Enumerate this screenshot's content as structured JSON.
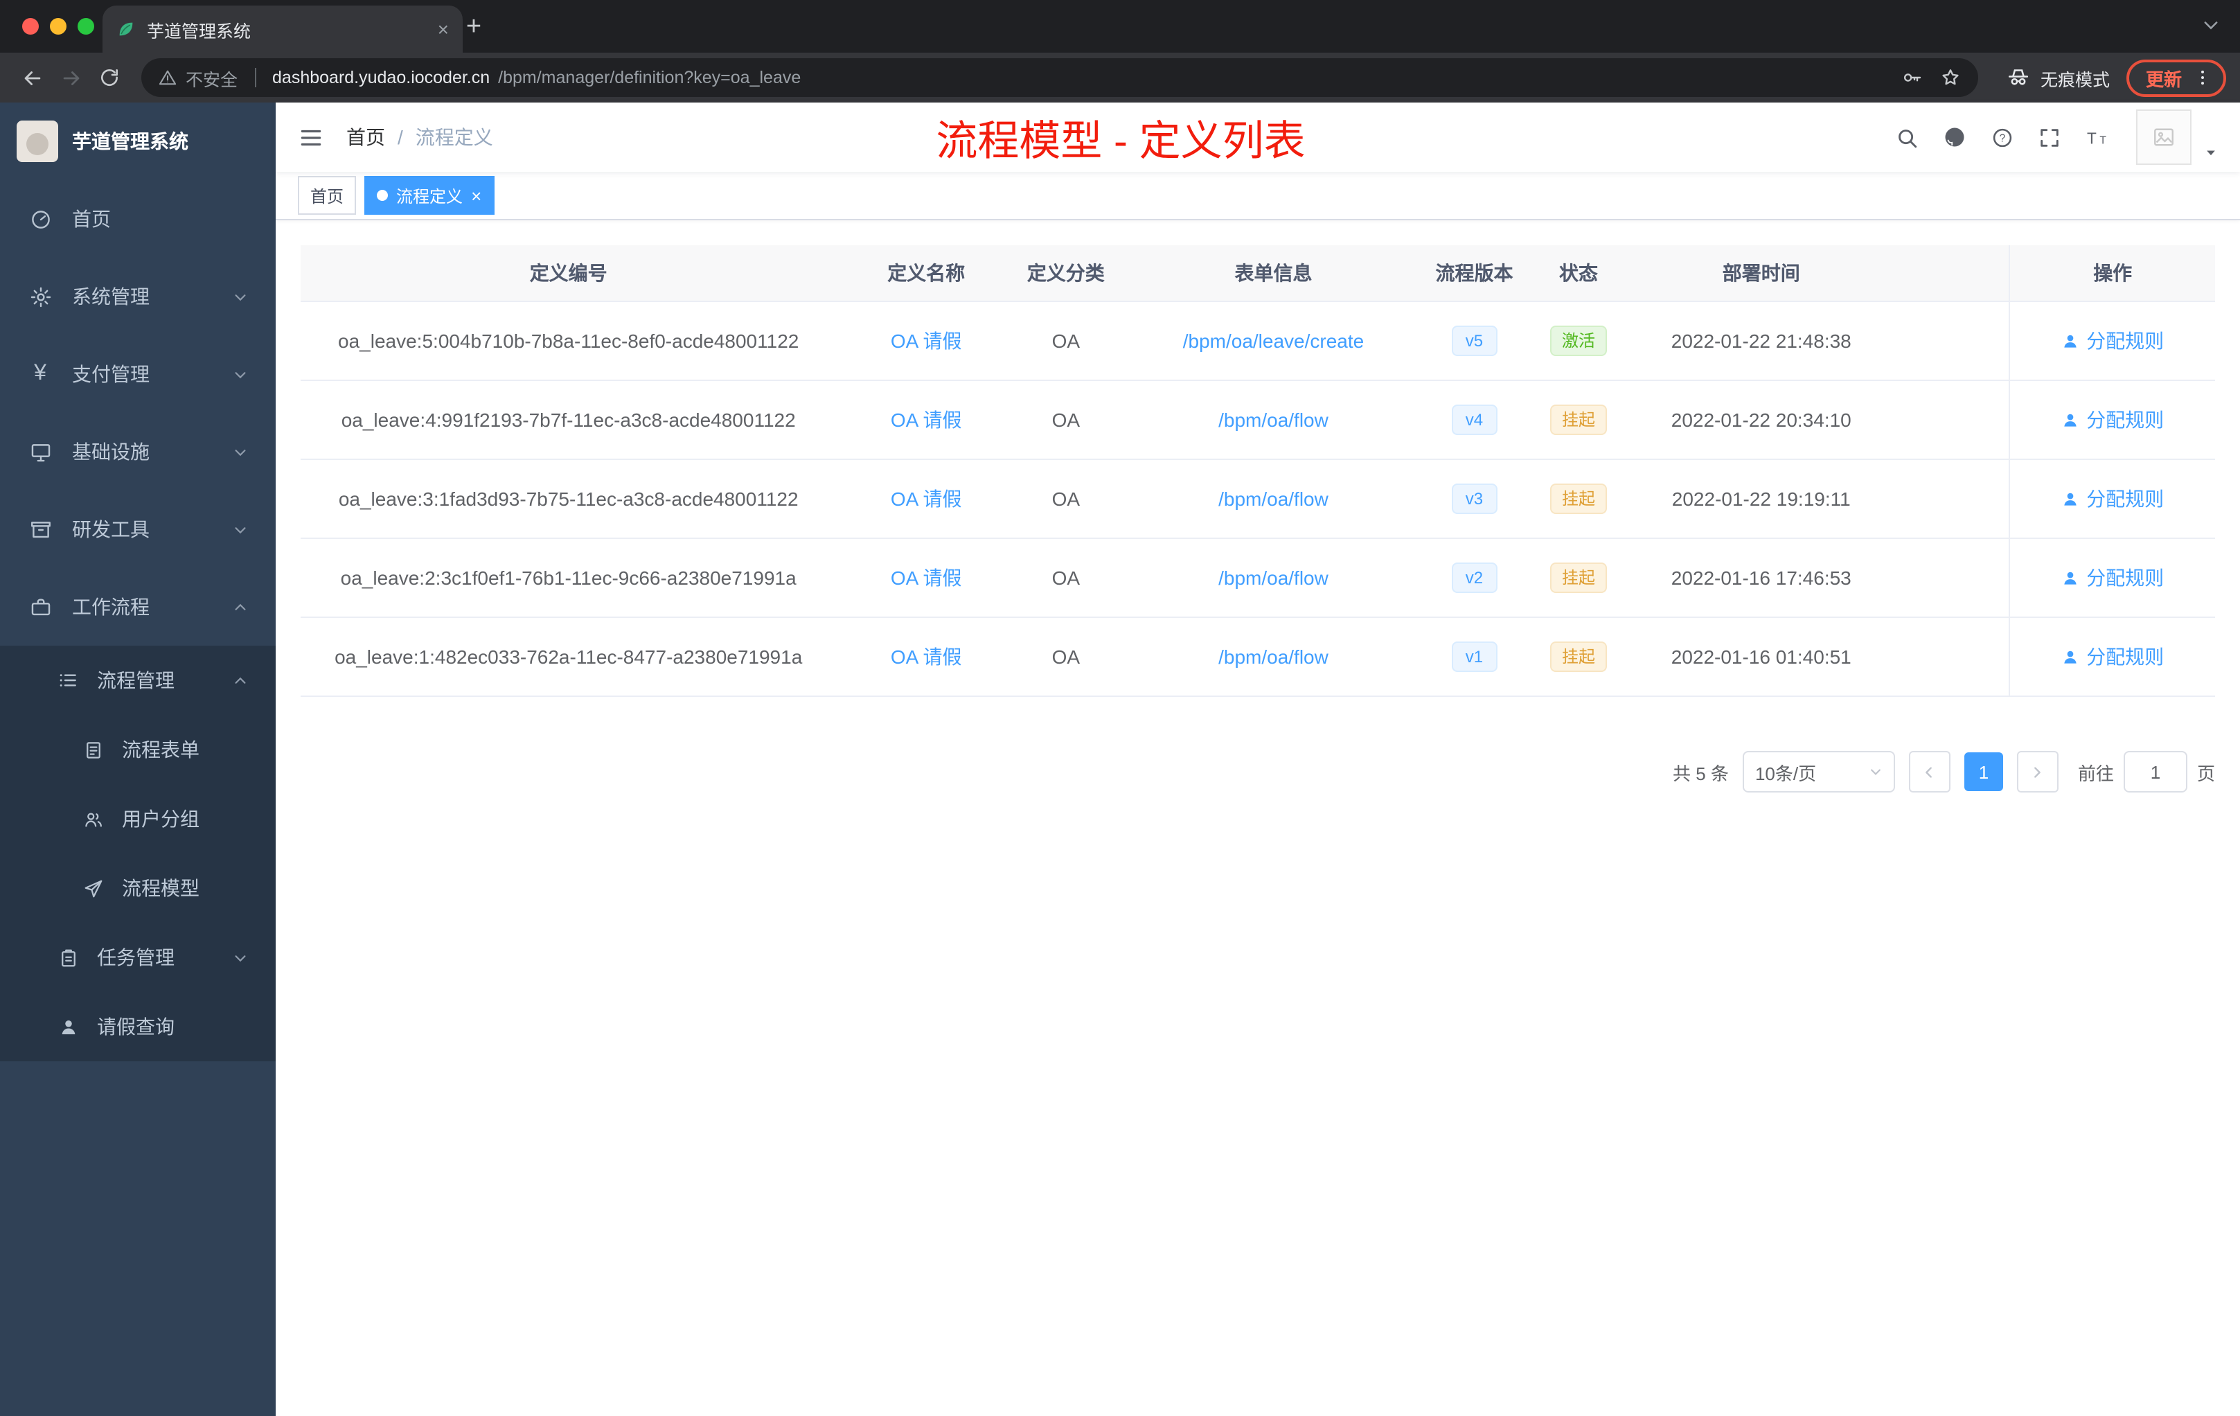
{
  "browser": {
    "tab_title": "芋道管理系统",
    "not_secure": "不安全",
    "url_host": "dashboard.yudao.iocoder.cn",
    "url_path": "/bpm/manager/definition?key=oa_leave",
    "incognito_label": "无痕模式",
    "update_label": "更新"
  },
  "sidebar": {
    "logo_title": "芋道管理系统",
    "items": [
      {
        "label": "首页"
      },
      {
        "label": "系统管理"
      },
      {
        "label": "支付管理"
      },
      {
        "label": "基础设施"
      },
      {
        "label": "研发工具"
      },
      {
        "label": "工作流程"
      }
    ],
    "process_group": {
      "label": "流程管理"
    },
    "process_children": [
      {
        "label": "流程表单"
      },
      {
        "label": "用户分组"
      },
      {
        "label": "流程模型"
      }
    ],
    "task_group": {
      "label": "任务管理"
    },
    "leave_item": {
      "label": "请假查询"
    }
  },
  "header": {
    "breadcrumb_home": "首页",
    "breadcrumb_sep": "/",
    "breadcrumb_current": "流程定义",
    "annotation": "流程模型 - 定义列表"
  },
  "tags": {
    "home": "首页",
    "active": "流程定义",
    "close": "×"
  },
  "table": {
    "headers": [
      "定义编号",
      "定义名称",
      "定义分类",
      "表单信息",
      "流程版本",
      "状态",
      "部署时间",
      "操作"
    ],
    "rows": [
      {
        "id": "oa_leave:5:004b710b-7b8a-11ec-8ef0-acde48001122",
        "name": "OA 请假",
        "category": "OA",
        "form": "/bpm/oa/leave/create",
        "version": "v5",
        "status": "激活",
        "time": "2022-01-22 21:48:38",
        "action": "分配规则"
      },
      {
        "id": "oa_leave:4:991f2193-7b7f-11ec-a3c8-acde48001122",
        "name": "OA 请假",
        "category": "OA",
        "form": "/bpm/oa/flow",
        "version": "v4",
        "status": "挂起",
        "time": "2022-01-22 20:34:10",
        "action": "分配规则"
      },
      {
        "id": "oa_leave:3:1fad3d93-7b75-11ec-a3c8-acde48001122",
        "name": "OA 请假",
        "category": "OA",
        "form": "/bpm/oa/flow",
        "version": "v3",
        "status": "挂起",
        "time": "2022-01-22 19:19:11",
        "action": "分配规则"
      },
      {
        "id": "oa_leave:2:3c1f0ef1-76b1-11ec-9c66-a2380e71991a",
        "name": "OA 请假",
        "category": "OA",
        "form": "/bpm/oa/flow",
        "version": "v2",
        "status": "挂起",
        "time": "2022-01-16 17:46:53",
        "action": "分配规则"
      },
      {
        "id": "oa_leave:1:482ec033-762a-11ec-8477-a2380e71991a",
        "name": "OA 请假",
        "category": "OA",
        "form": "/bpm/oa/flow",
        "version": "v1",
        "status": "挂起",
        "time": "2022-01-16 01:40:51",
        "action": "分配规则"
      }
    ]
  },
  "pagination": {
    "total": "共 5 条",
    "page_size": "10条/页",
    "page": "1",
    "goto_label": "前往",
    "goto_value": "1",
    "unit": "页"
  },
  "colors": {
    "accent": "#409eff",
    "success": "#67c23a",
    "warning": "#e6a23c",
    "sidebar_bg": "#304156",
    "annotation_red": "#f21d0d"
  },
  "icons": {
    "tab-favicon": "leaf",
    "warning-icon": "triangle-exclamation",
    "key-icon": "key",
    "star-icon": "star",
    "incognito-icon": "spy",
    "kebab-icon": "vertical-dots",
    "hamburger-icon": "three-lines",
    "search-icon": "magnifier",
    "github-icon": "github-mark",
    "help-icon": "question-circle",
    "fullscreen-icon": "expand-corners",
    "font-size-icon": "Tt",
    "user-icon": "person"
  }
}
